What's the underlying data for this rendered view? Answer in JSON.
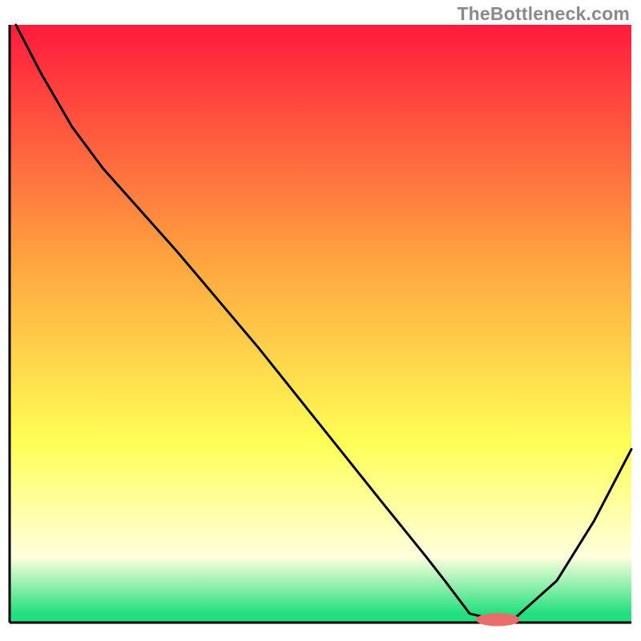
{
  "attribution": "TheBottleneck.com",
  "colors": {
    "red": "#ff1a3e",
    "orange": "#ffa63f",
    "yellow": "#ffff56",
    "paleYellow": "#ffffde",
    "green": "#22e07d",
    "axis": "#000000",
    "curve": "#000000",
    "marker": "#e86d6c"
  },
  "chart_data": {
    "type": "line",
    "title": "",
    "xlabel": "",
    "ylabel": "",
    "x": [
      0.01,
      0.05,
      0.1,
      0.15,
      0.27,
      0.4,
      0.5,
      0.6,
      0.67,
      0.7,
      0.74,
      0.78,
      0.81,
      0.88,
      0.94,
      1.0
    ],
    "values": [
      1.0,
      0.92,
      0.83,
      0.76,
      0.62,
      0.46,
      0.33,
      0.2,
      0.11,
      0.07,
      0.015,
      0.005,
      0.005,
      0.07,
      0.17,
      0.29
    ],
    "xlim": [
      0,
      1
    ],
    "ylim": [
      0,
      1
    ],
    "marker": {
      "x": 0.785,
      "y": 0.005,
      "rx": 0.035,
      "ry": 0.011
    },
    "gradient_bands": [
      {
        "offset": 0.0,
        "color_key": "red"
      },
      {
        "offset": 0.4,
        "color_key": "orange"
      },
      {
        "offset": 0.7,
        "color_key": "yellow"
      },
      {
        "offset": 0.89,
        "color_key": "paleYellow"
      },
      {
        "offset": 0.985,
        "color_key": "green"
      }
    ]
  }
}
